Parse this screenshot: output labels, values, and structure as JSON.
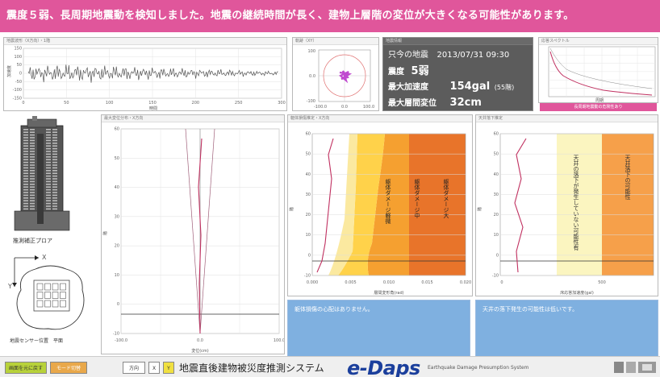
{
  "banner": {
    "text": "震度５弱、長周期地震動を検知しました。地震の継続時間が長く、建物上層階の変位が大きくなる可能性があります。"
  },
  "panels": {
    "waveform": {
      "title": "地震波形（X方向）・1階",
      "ylabel": "加速度",
      "xlabel": "時間",
      "yticks": [
        "150",
        "100",
        "50",
        "0",
        "-50",
        "-100",
        "-150"
      ],
      "xticks": [
        "0",
        "50",
        "100",
        "150",
        "200",
        "250",
        "300"
      ]
    },
    "orbit": {
      "title": "軌跡（XY）",
      "yticks": [
        "100",
        "0.0",
        "-100"
      ],
      "xticks": [
        "-100.0",
        "0.0",
        "100.0"
      ]
    },
    "info": {
      "title": "地震情報",
      "time_label": "只今の地震",
      "time_value": "2013/07/31 09:30",
      "intensity_label": "震度",
      "intensity_value": "5弱",
      "accel_label": "最大加速度",
      "accel_value": "154gal",
      "accel_note": "(55階)",
      "disp_label": "最大層間変位",
      "disp_value": "32cm"
    },
    "spectrum": {
      "title": "応答スペクトル",
      "xlabel": "周期",
      "footer": "長周期地震動の危険性あり"
    },
    "building": {
      "label": "推測補正プロア",
      "axis_x": "X",
      "axis_y": "Y",
      "plan_label": "地震センサー位置　平面"
    },
    "displacement": {
      "title": "最大変位分布・X方向",
      "ylabel": "階",
      "xlabel": "変位(cm)",
      "yticks": [
        "60",
        "50",
        "40",
        "30",
        "20",
        "10",
        "0",
        "-10"
      ],
      "xticks": [
        "-100.0",
        "0.0",
        "100.0"
      ]
    },
    "damage": {
      "title": "躯体損傷推定・X方向",
      "ylabel": "階",
      "xlabel": "層間変形角(rad)",
      "yticks": [
        "60",
        "50",
        "40",
        "30",
        "20",
        "10",
        "0",
        "-10"
      ],
      "xticks": [
        "0.000",
        "0.005",
        "0.010",
        "0.015",
        "0.020"
      ],
      "zone_small": "躯体ダメージ軽微",
      "zone_medium": "躯体ダメージ中",
      "zone_large": "躯体ダメージ大",
      "message": "躯体損傷の心配はありません。"
    },
    "ceiling": {
      "title": "天井落下推定",
      "ylabel": "階",
      "xlabel": "床応答加速度(gal)",
      "yticks": [
        "60",
        "50",
        "40",
        "30",
        "20",
        "10",
        "0",
        "-10"
      ],
      "xticks": [
        "0",
        "500"
      ],
      "zone_low": "天井の落下が発生していない可能性有",
      "zone_high": "天井落下の可能性",
      "message": "天井の落下発生の可能性は低いです。"
    }
  },
  "footer": {
    "btn_warning": "画面を元に戻す",
    "btn_mode": "モード切替",
    "btn_direction": "方向",
    "btn_x": "X",
    "btn_y": "Y",
    "system_title": "地震直後建物被災度推測システム",
    "logo": "e-Daps",
    "logo_sub": "Earthquake Damage Presumption System"
  },
  "colors": {
    "banner": "#e0569b",
    "info_bg": "#5c5c5c",
    "message_bg": "#7fb0e0",
    "zone_small": "#ffd24a",
    "zone_medium": "#f5a030",
    "zone_large": "#e8742a",
    "zone_ceiling_low": "#fbf5c0",
    "zone_ceiling_high": "#f6a04a",
    "curve": "#c03060",
    "logo": "#1b3f9c"
  }
}
